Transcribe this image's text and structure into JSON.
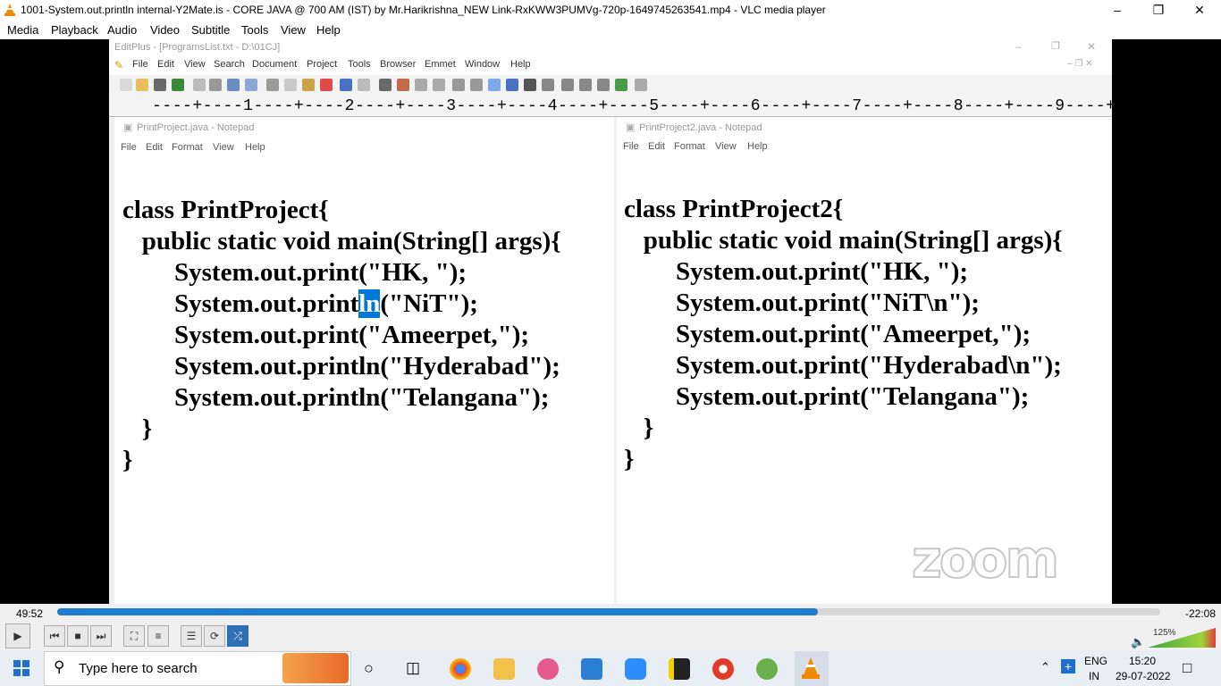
{
  "vlc": {
    "title": "1001-System.out.println internal-Y2Mate.is - CORE JAVA @ 700 AM (IST) by Mr.Harikrishna_NEW Link-RxKWW3PUMVg-720p-1649745263541.mp4 - VLC media player",
    "menu": [
      "Media",
      "Playback",
      "Audio",
      "Video",
      "Subtitle",
      "Tools",
      "View",
      "Help"
    ],
    "time_elapsed": "49:52",
    "time_remaining": "-22:08",
    "progress": 0.69,
    "volume": "125%",
    "accent": "#1e7fd0"
  },
  "editplus": {
    "title": "EditPlus - [ProgramsList.txt - D:\\01CJ]",
    "menu": [
      "File",
      "Edit",
      "View",
      "Search",
      "Document",
      "Project",
      "Tools",
      "Browser",
      "Emmet",
      "Window",
      "Help"
    ],
    "ruler": "----+----1----+----2----+----3----+----4----+----5----+----6----+----7----+----8----+----9----+----0----+----1----+----2"
  },
  "notepad_left": {
    "title": "PrintProject.java - Notepad",
    "menu": [
      "File",
      "Edit",
      "Format",
      "View",
      "Help"
    ],
    "lines": [
      "class PrintProject{",
      "   public static void main(String[] args){",
      "        System.out.print(\"HK, \");",
      "        System.out.print",
      "ln",
      "(\"NiT\");",
      "        System.out.print(\"Ameerpet,\");",
      "        System.out.println(\"Hyderabad\");",
      "        System.out.println(\"Telangana\");",
      "   }",
      "}"
    ]
  },
  "notepad_right": {
    "title": "PrintProject2.java - Notepad",
    "menu": [
      "File",
      "Edit",
      "Format",
      "View",
      "Help"
    ],
    "lines": [
      "class PrintProject2{",
      "   public static void main(String[] args){",
      "        System.out.print(\"HK, \");",
      "        System.out.print(\"NiT\\n\");",
      "        System.out.print(\"Ameerpet,\");",
      "        System.out.print(\"Hyderabad\\n\");",
      "        System.out.print(\"Telangana\");",
      "   }",
      "}"
    ]
  },
  "zoom_logo": "zoom",
  "taskbar": {
    "search_placeholder": "Type here to search",
    "lang": "ENG",
    "region": "IN",
    "time": "15:20",
    "date": "29-07-2022"
  }
}
